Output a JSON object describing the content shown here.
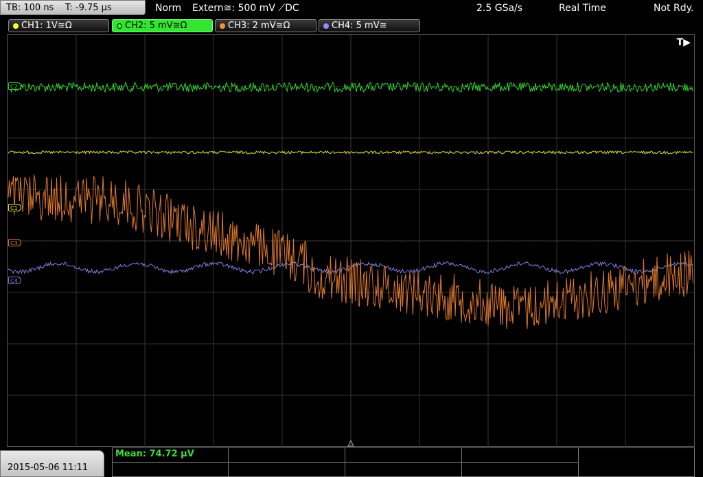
{
  "header": {
    "timebase": "TB: 100 ns",
    "trigger_time": "T: -9.75 µs",
    "mode": "Norm",
    "trigger": "Extern≅: 500 mV ⟋DC",
    "sample_rate": "2.5 GSa/s",
    "acq_mode": "Real Time",
    "status": "Not Rdy."
  },
  "channels": [
    {
      "label": "CH1: 1V≅Ω",
      "color": "#ffff33",
      "active": false
    },
    {
      "label": "CH2: 5 mV≅Ω",
      "color": "#33ff33",
      "active": true
    },
    {
      "label": "CH3: 2 mV≅Ω",
      "color": "#ff8c3a",
      "active": false
    },
    {
      "label": "CH4: 5 mV≅",
      "color": "#8f8fff",
      "active": false
    }
  ],
  "markers": {
    "ch1": "C1",
    "ch2": "C2",
    "ch3": "C3",
    "ch4": "C4"
  },
  "trigger_indicator": "T▶",
  "footer": {
    "datetime": "2015-05-06 11:11",
    "measurement": "Mean: 74.72 µV"
  },
  "colors": {
    "ch1": "#e7e731",
    "ch2": "#2fd82f",
    "ch3": "#e07a2c",
    "ch4": "#8080e0",
    "grid": "#3c3c3c"
  }
}
